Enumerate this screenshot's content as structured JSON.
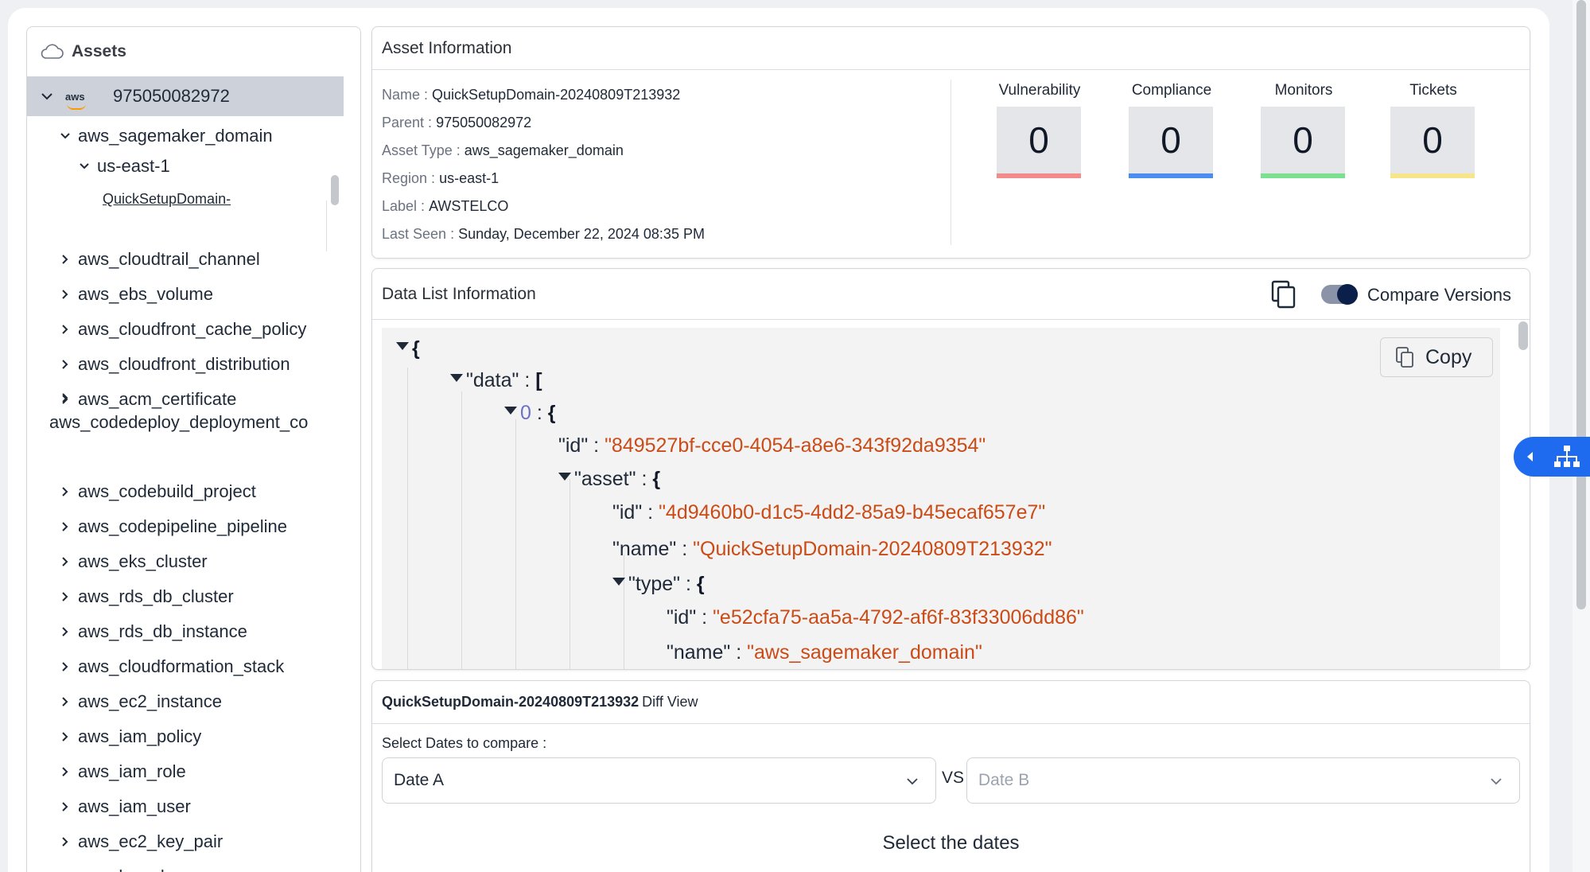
{
  "sidebar": {
    "title": "Assets",
    "title_icon": "cloud-icon",
    "root": {
      "provider": "aws",
      "account": "975050082972"
    },
    "domain_node": "aws_sagemaker_domain",
    "region_node": "us-east-1",
    "leaf": "QuickSetupDomain-",
    "items": [
      "aws_cloudtrail_channel",
      "aws_ebs_volume",
      "aws_cloudfront_cache_policy",
      "aws_cloudfront_distribution",
      "aws_acm_certificate",
      "aws_codedeploy_deployment_co",
      "aws_codebuild_project",
      "aws_codepipeline_pipeline",
      "aws_eks_cluster",
      "aws_rds_db_cluster",
      "aws_rds_db_instance",
      "aws_cloudformation_stack",
      "aws_ec2_instance",
      "aws_iam_policy",
      "aws_iam_role",
      "aws_iam_user",
      "aws_ec2_key_pair",
      "aws_kms_key"
    ]
  },
  "asset_info": {
    "title": "Asset Information",
    "fields": [
      {
        "key": "Name : ",
        "value": "QuickSetupDomain-20240809T213932"
      },
      {
        "key": "Parent : ",
        "value": "975050082972"
      },
      {
        "key": "Asset Type : ",
        "value": "aws_sagemaker_domain"
      },
      {
        "key": "Region : ",
        "value": "us-east-1"
      },
      {
        "key": "Label : ",
        "value": "AWSTELCO"
      },
      {
        "key": "Last Seen : ",
        "value": "Sunday, December 22, 2024 08:35 PM"
      }
    ],
    "stats": [
      {
        "label": "Vulnerability",
        "value": "0",
        "color": "#f28b8b"
      },
      {
        "label": "Compliance",
        "value": "0",
        "color": "#4a8ff0"
      },
      {
        "label": "Monitors",
        "value": "0",
        "color": "#7be08f"
      },
      {
        "label": "Tickets",
        "value": "0",
        "color": "#f7e58a"
      }
    ]
  },
  "data_list": {
    "title": "Data List Information",
    "compare_label": "Compare Versions",
    "compare_on": true,
    "copy_label": "Copy",
    "json": {
      "open_brace": "{",
      "data_key": "\"data\"",
      "data_open": "[",
      "index": "0",
      "index_open": "{",
      "id_key": "\"id\"",
      "id_value": "\"849527bf-cce0-4054-a8e6-343f92da9354\"",
      "asset_key": "\"asset\"",
      "asset_open": "{",
      "asset_id_key": "\"id\"",
      "asset_id_value": "\"4d9460b0-d1c5-4dd2-85a9-b45ecaf657e7\"",
      "asset_name_key": "\"name\"",
      "asset_name_value": "\"QuickSetupDomain-20240809T213932\"",
      "type_key": "\"type\"",
      "type_open": "{",
      "type_id_key": "\"id\"",
      "type_id_value": "\"e52cfa75-aa5a-4792-af6f-83f33006dd86\"",
      "type_name_key": "\"name\"",
      "type_name_value": "\"aws_sagemaker_domain\""
    }
  },
  "diff": {
    "asset_name": "QuickSetupDomain-20240809T213932",
    "title_suffix": "Diff View",
    "select_label": "Select Dates to compare :",
    "date_a": "Date A",
    "vs": "VS",
    "date_b_placeholder": "Date B",
    "empty_message": "Select the dates"
  }
}
